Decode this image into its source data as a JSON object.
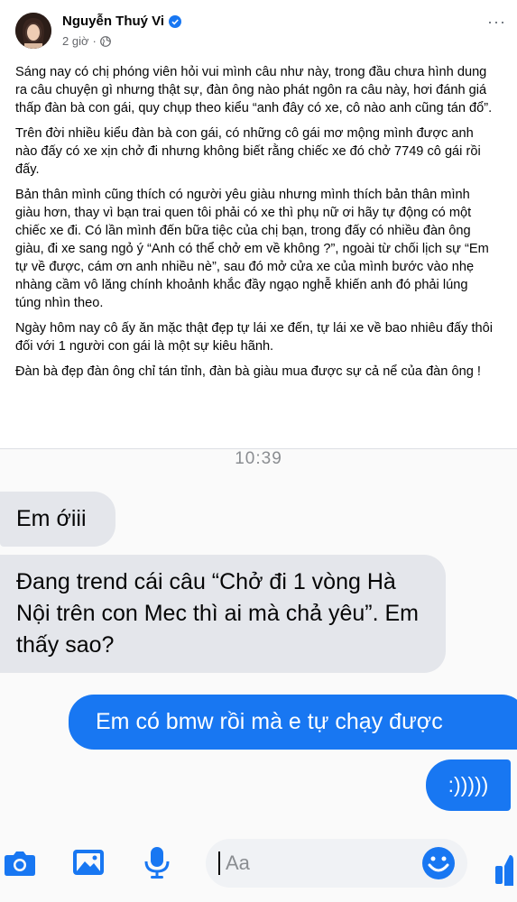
{
  "post": {
    "author": "Nguyễn Thuý Vi",
    "time": "2 giờ",
    "dot": "·",
    "more": "···",
    "paragraphs": [
      "Sáng nay có chị phóng viên hỏi vui mình câu như này, trong đầu chưa hình dung ra câu chuyện gì nhưng thật sự, đàn ông nào phát ngôn ra câu này, hơi đánh giá thấp đàn bà con gái, quy chụp theo kiểu “anh đây có xe, cô nào anh cũng tán đổ”.",
      "Trên đời nhiều kiểu đàn bà con gái, có những cô gái mơ mộng mình được anh nào đấy có xe xịn chở đi nhưng không biết rằng chiếc xe đó chở 7749 cô gái rồi đấy.",
      "Bản thân mình cũng thích có người yêu giàu nhưng mình thích bản thân mình giàu hơn, thay vì bạn trai quen tôi phải có xe thì phụ nữ ơi hãy tự động có một chiếc xe đi. Có lần mình đến bữa tiệc của chị bạn, trong đấy có nhiều đàn ông giàu, đi xe sang ngỏ ý “Anh có thể chở em về không ?”, ngoài từ chối lịch sự “Em tự về được, cám ơn anh nhiều nè”, sau đó mở cửa xe của mình bước vào nhẹ nhàng cầm vô lăng chính khoảnh khắc đầy ngạo nghễ khiến anh đó phải lúng túng nhìn theo.",
      "Ngày hôm nay cô ấy ăn mặc thật đẹp tự lái xe đến, tự lái xe về bao nhiêu đấy thôi đối với 1 người con gái là một sự kiêu hãnh.",
      "Đàn bà đẹp đàn ông chỉ tán tỉnh, đàn bà giàu mua được sự cả nể của đàn ông !"
    ]
  },
  "chat": {
    "time": "10:39",
    "messages": [
      {
        "from": "them",
        "text": "Em ớiii"
      },
      {
        "from": "them",
        "text": "Đang trend cái câu “Chở đi 1 vòng Hà Nội trên con Mec thì ai mà chả yêu”. Em thấy sao?"
      },
      {
        "from": "me",
        "text": "Em có bmw rồi mà e tự chạy được"
      },
      {
        "from": "me",
        "text": ":)))))"
      }
    ],
    "composer_placeholder": "Aa"
  },
  "icons": [
    "camera-icon",
    "image-icon",
    "microphone-icon",
    "emoji-icon",
    "like-icon"
  ],
  "colors": {
    "accent": "#1877f2",
    "incoming_bubble": "#e4e6eb",
    "muted": "#65676b"
  }
}
